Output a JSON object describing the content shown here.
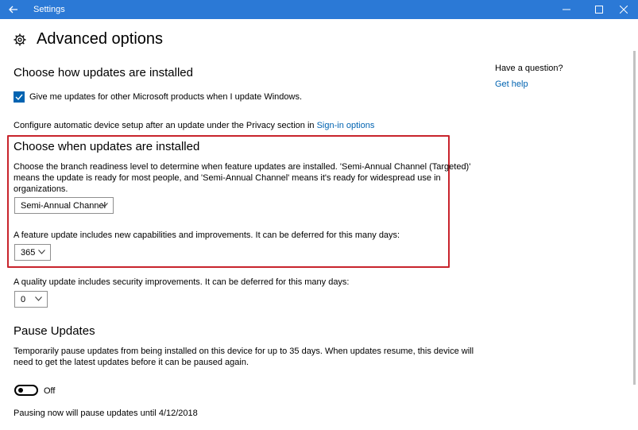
{
  "titlebar": {
    "title": "Settings"
  },
  "page": {
    "title": "Advanced options"
  },
  "install_section": {
    "heading": "Choose how updates are installed",
    "checkbox_label": "Give me updates for other Microsoft products when I update Windows.",
    "checkbox_checked": true,
    "privacy_text": "Configure automatic device setup after an update under the Privacy section in",
    "privacy_link": "Sign-in options"
  },
  "when_section": {
    "heading": "Choose when updates are installed",
    "description_line1": "Choose the branch readiness level to determine when feature updates are installed. 'Semi-Annual Channel (Targeted)'",
    "description_line2": "means the update is ready for most people, and 'Semi-Annual Channel' means it's ready for widespread use in",
    "description_line3": "organizations.",
    "branch_dropdown": "Semi-Annual Channel",
    "feature_text": "A feature update includes new capabilities and improvements. It can be deferred for this many days:",
    "feature_days": "365"
  },
  "quality_section": {
    "text": "A quality update includes security improvements. It can be deferred for this many days:",
    "days": "0"
  },
  "pause_section": {
    "heading": "Pause Updates",
    "description_line1": "Temporarily pause updates from being installed on this device for up to 35 days. When updates resume, this device will",
    "description_line2": "need to get the latest updates before it can be paused again.",
    "toggle_label": "Off",
    "footer": "Pausing now will pause updates until 4/12/2018"
  },
  "side": {
    "question": "Have a question?",
    "help_link": "Get help"
  },
  "colors": {
    "titlebar": "#2b79d6",
    "accent": "#0063b1",
    "highlight": "#c8242c"
  }
}
